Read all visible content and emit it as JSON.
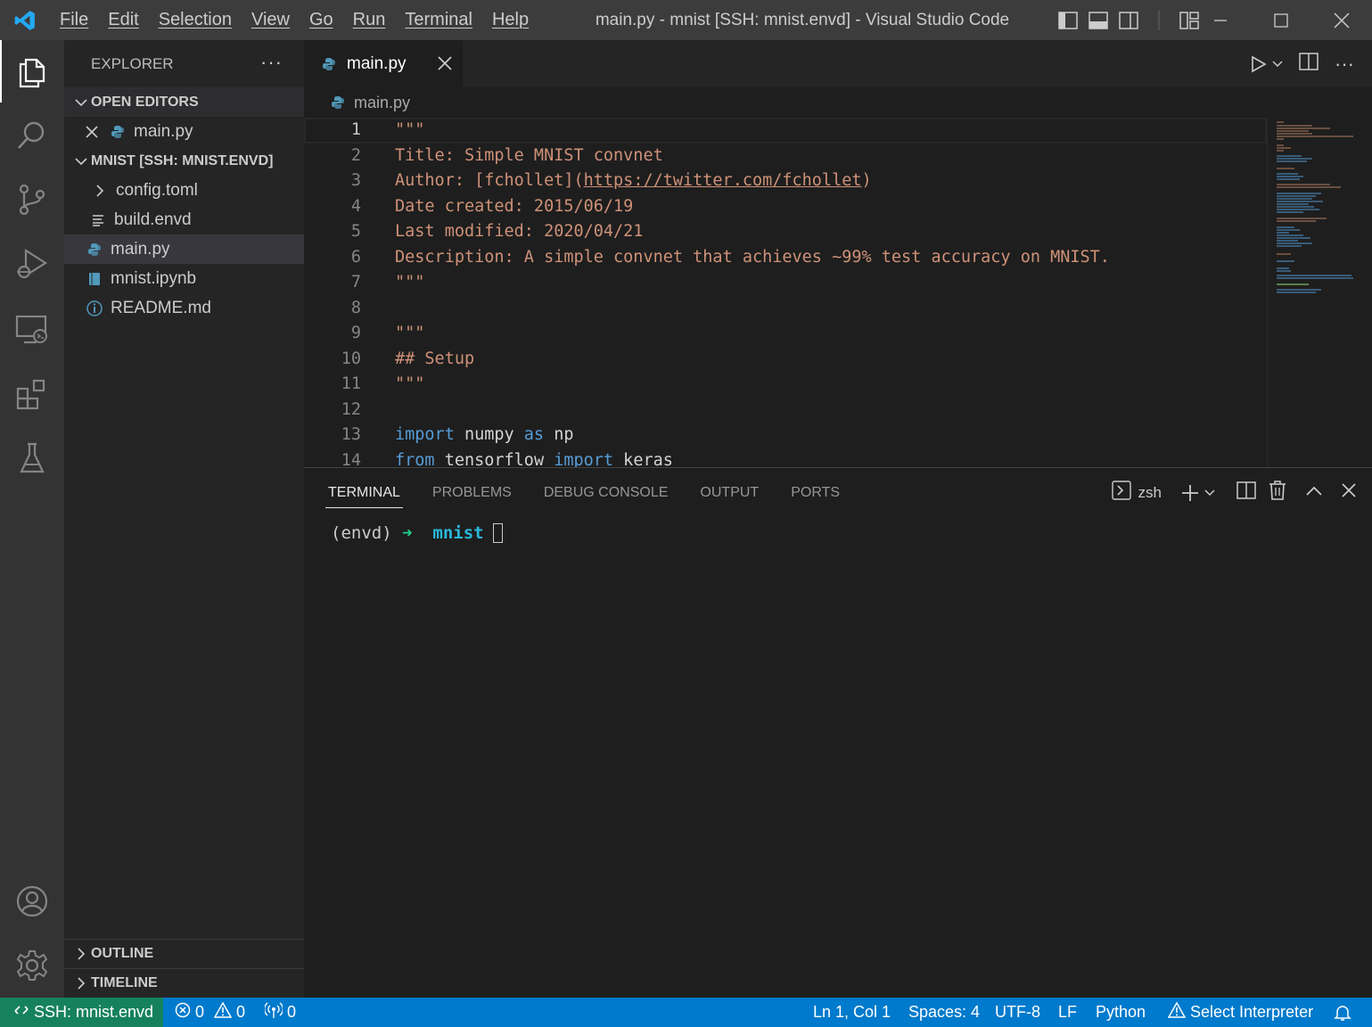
{
  "titlebar": {
    "menus": [
      "File",
      "Edit",
      "Selection",
      "View",
      "Go",
      "Run",
      "Terminal",
      "Help"
    ],
    "title": "main.py - mnist [SSH: mnist.envd] - Visual Studio Code"
  },
  "sidebar": {
    "header": "EXPLORER",
    "more": "···",
    "open_editors_label": "OPEN EDITORS",
    "open_editors": [
      "main.py"
    ],
    "folder_label": "MNIST [SSH: MNIST.ENVD]",
    "files": [
      "config.toml",
      "build.envd",
      "main.py",
      "mnist.ipynb",
      "README.md"
    ],
    "outline_label": "OUTLINE",
    "timeline_label": "TIMELINE"
  },
  "editor": {
    "tab_label": "main.py",
    "breadcrumb": "main.py",
    "line_numbers": [
      "1",
      "2",
      "3",
      "4",
      "5",
      "6",
      "7",
      "8",
      "9",
      "10",
      "11",
      "12",
      "13",
      "14"
    ],
    "code": {
      "l1": "\"\"\"",
      "l2": "Title: Simple MNIST convnet",
      "l3a": "Author: [fchollet](",
      "l3b": "https://twitter.com/fchollet",
      "l3c": ")",
      "l4": "Date created: 2015/06/19",
      "l5": "Last modified: 2020/04/21",
      "l6": "Description: A simple convnet that achieves ~99% test accuracy on MNIST.",
      "l7": "\"\"\"",
      "l9": "\"\"\"",
      "l10": "## Setup",
      "l11": "\"\"\"",
      "l13_kw1": "import",
      "l13_mod": " numpy ",
      "l13_kw2": "as",
      "l13_alias": " np",
      "l14_kw1": "from",
      "l14_mod": " tensorflow ",
      "l14_kw2": "import",
      "l14_name": " keras"
    }
  },
  "panel": {
    "tabs": [
      "TERMINAL",
      "PROBLEMS",
      "DEBUG CONSOLE",
      "OUTPUT",
      "PORTS"
    ],
    "shell": "zsh",
    "terminal": {
      "env": "(envd) ",
      "arrow": "➜",
      "dir": "  mnist"
    }
  },
  "statusbar": {
    "remote": "SSH: mnist.envd",
    "errors": "0",
    "warnings": "0",
    "ports": "0",
    "position": "Ln 1, Col 1",
    "spaces": "Spaces: 4",
    "encoding": "UTF-8",
    "eol": "LF",
    "language": "Python",
    "interpreter": "Select Interpreter"
  },
  "colors": {
    "accent": "#007acc",
    "remote": "#16825d",
    "string": "#ce9178",
    "keyword": "#569cd6"
  }
}
